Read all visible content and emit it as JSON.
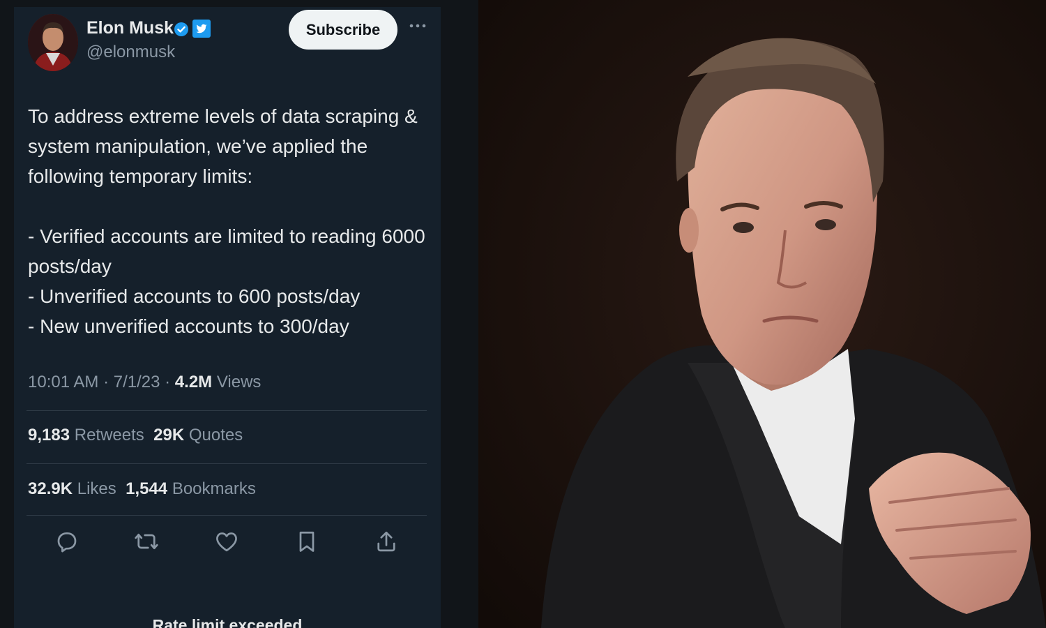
{
  "tweet": {
    "author_name": "Elon Musk",
    "handle": "@elonmusk",
    "subscribe_label": "Subscribe",
    "text_paragraph": "To address extreme levels of data scraping & system manipulation, we’ve applied the following temporary limits:",
    "limits": [
      "- Verified accounts are limited to reading 6000 posts/day",
      "- Unverified accounts to 600 posts/day",
      "- New unverified accounts to 300/day"
    ],
    "time": "10:01 AM",
    "date": "7/1/23",
    "views_count": "4.2M",
    "views_label": "Views",
    "retweets_count": "9,183",
    "retweets_label": "Retweets",
    "quotes_count": "29K",
    "quotes_label": "Quotes",
    "likes_count": "32.9K",
    "likes_label": "Likes",
    "bookmarks_count": "1,544",
    "bookmarks_label": "Bookmarks",
    "rate_limit_message": "Rate limit exceeded"
  },
  "icons": {
    "verified": "verified-badge-icon",
    "platform": "twitter-bird-icon",
    "more": "more-dots-icon",
    "reply": "reply-icon",
    "retweet": "retweet-icon",
    "like": "heart-icon",
    "bookmark": "bookmark-icon",
    "share": "share-icon"
  },
  "colors": {
    "card_background": "#15202b",
    "text_primary": "#e7e9ea",
    "text_secondary": "#8b98a5",
    "accent": "#1d9bf0",
    "button_background": "#eff3f4"
  }
}
